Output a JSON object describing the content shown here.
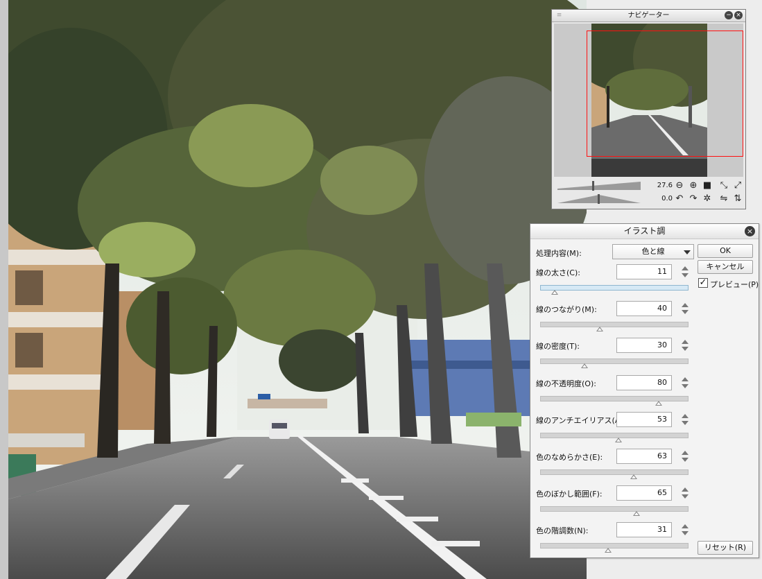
{
  "navigator": {
    "title": "ナビゲーター",
    "zoom": "27.6",
    "rotation": "0.0",
    "viewport_color": "#ff1010"
  },
  "dialog": {
    "title": "イラスト調",
    "mode_label": "処理内容(M):",
    "mode_value": "色と線",
    "ok_label": "OK",
    "cancel_label": "キャンセル",
    "preview_label": "プレビュー(P)",
    "preview_checked": true,
    "reset_label": "リセット(R)",
    "params": [
      {
        "label": "線の太さ(C):",
        "value": "11",
        "level": 0.1
      },
      {
        "label": "線のつながり(M):",
        "value": "40",
        "level": 0.4
      },
      {
        "label": "線の密度(T):",
        "value": "30",
        "level": 0.3
      },
      {
        "label": "線の不透明度(O):",
        "value": "80",
        "level": 0.8
      },
      {
        "label": "線のアンチエイリアス(A):",
        "value": "53",
        "level": 0.53
      },
      {
        "label": "色のなめらかさ(E):",
        "value": "63",
        "level": 0.63
      },
      {
        "label": "色のぼかし範囲(F):",
        "value": "65",
        "level": 0.65
      },
      {
        "label": "色の階調数(N):",
        "value": "31",
        "level": 0.46
      }
    ]
  }
}
